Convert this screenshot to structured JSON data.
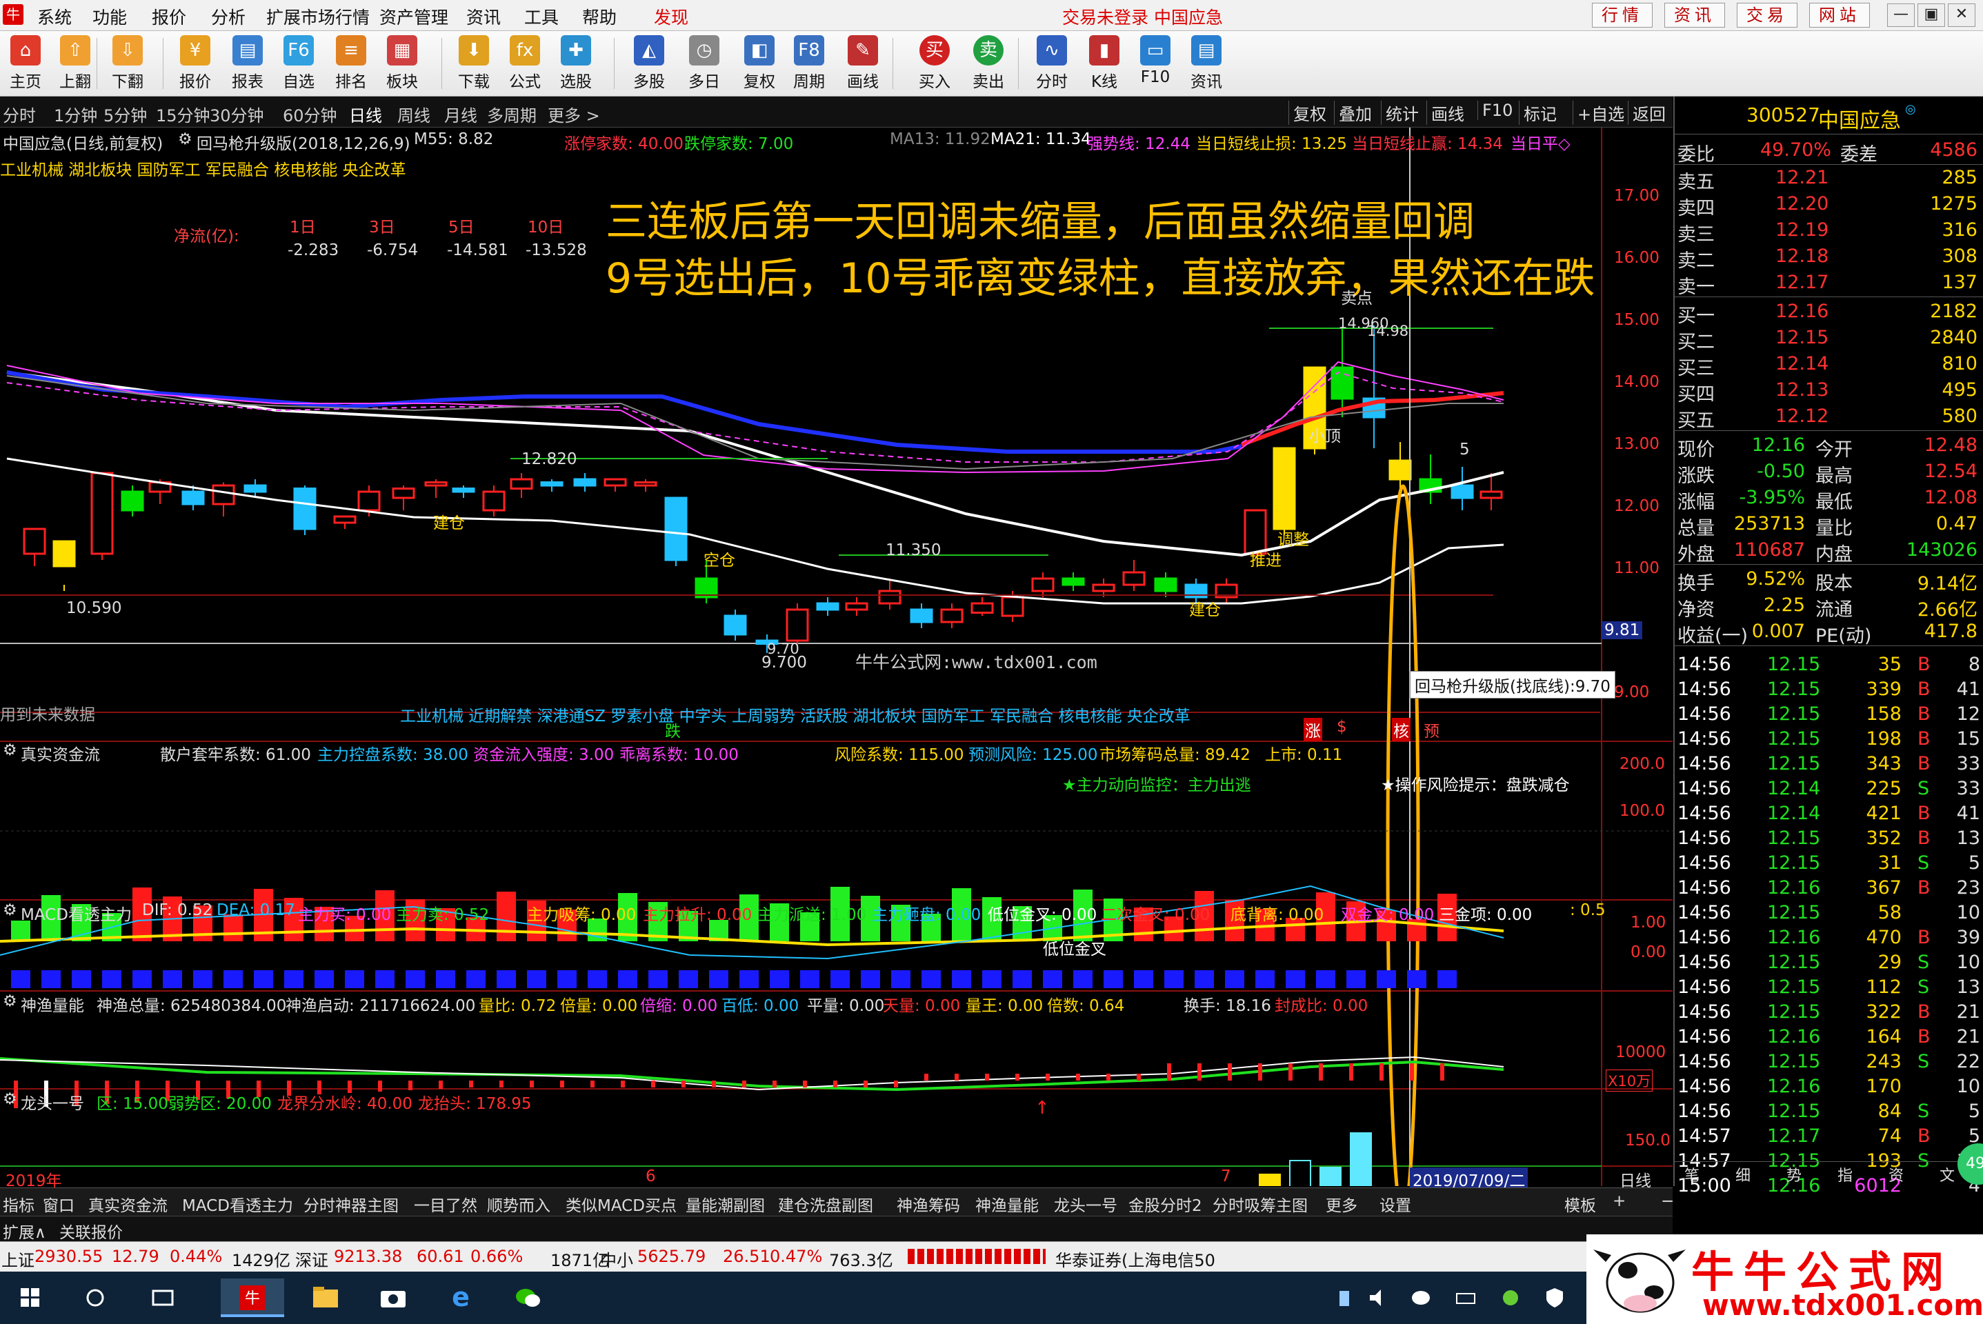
{
  "menu": {
    "items": [
      "系统",
      "功能",
      "报价",
      "分析",
      "扩展市场行情",
      "资产管理",
      "资讯",
      "工具",
      "帮助",
      "发现"
    ],
    "login_status": "交易未登录 中国应急",
    "quick_links": [
      "行情",
      "资讯",
      "交易",
      "网站"
    ],
    "window_buttons": [
      "—",
      "▣",
      "✕"
    ]
  },
  "toolbar": {
    "items": [
      "主页",
      "上翻",
      "下翻",
      "报价",
      "报表",
      "自选",
      "排名",
      "板块",
      "下载",
      "公式",
      "选股",
      "多股",
      "多日",
      "复权",
      "周期",
      "画线",
      "买入",
      "卖出",
      "分时",
      "K线",
      "F10",
      "资讯"
    ]
  },
  "periods": {
    "items": [
      "分时",
      "1分钟",
      "5分钟",
      "15分钟",
      "30分钟",
      "60分钟",
      "日线",
      "周线",
      "月线",
      "多周期",
      "更多 >"
    ],
    "active": "日线"
  },
  "chart_tools": [
    "复权",
    "叠加",
    "统计",
    "画线",
    "F10",
    "标记",
    "+自选",
    "返回"
  ],
  "main_chart": {
    "title": "中国应急(日线,前复权)",
    "indicator": "回马枪升级版(2018,12,26,9)",
    "ma55": "M55: 8.82",
    "limit_up": "涨停家数: 40.00",
    "limit_down": "跌停家数: 7.00",
    "ma13": "MA13: 11.92",
    "ma21": "MA21: 11.34",
    "strong_line": "强势线: 12.44",
    "stop_loss": "当日短线止损: 13.25",
    "stop_profit": "当日短线止赢: 14.34",
    "today_flat": "当日平◇",
    "concepts": "工业机械 湖北板块 国防军工 军民融合 核电核能 央企改革",
    "flow_label": "净流(亿):",
    "flow_headers": [
      "1日",
      "3日",
      "5日",
      "10日"
    ],
    "flow_values": [
      "-2.283",
      "-6.754",
      "-14.581",
      "-13.528"
    ],
    "annotation_line1": "三连板后第一天回调未缩量，后面虽然缩量回调",
    "annotation_line2": "9号选出后，10号乖离变绿柱，直接放弃，果然还在跌",
    "price_labels": [
      "17.00",
      "16.00",
      "15.00",
      "14.00",
      "13.00",
      "12.00",
      "11.00",
      "9.00"
    ],
    "current_price_tag": "9.81",
    "marks": {
      "sell_point": "卖点",
      "high": "14.960",
      "high2": "14.98",
      "peak": "12.820",
      "low1": "10.590",
      "low2": "9.700",
      "low3": "9.70",
      "mid": "11.350",
      "small_top": "小顶",
      "adjust": "调整",
      "push": "推进",
      "build1": "建仓",
      "build2": "建仓",
      "empty": "空仓",
      "five": "5"
    },
    "watermark": "牛牛公式网:www.tdx001.com",
    "tooltip": "回马枪升级版(找底线):9.70",
    "future_data": "用到未来数据",
    "concepts2": "工业机械 近期解禁 深港通SZ 罗素小盘 中字头 上周弱势 活跃股 湖北板块 国防军工 军民融合 核电核能 央企改革",
    "bottom_marks": [
      "跌",
      "涨",
      "$",
      "核",
      "预"
    ]
  },
  "ind1": {
    "name": "真实资金流",
    "values": [
      "散户套牢系数: 61.00",
      "主力控盘系数: 38.00",
      "资金流入强度: 3.00",
      "乖离系数: 10.00",
      "风险系数: 115.00",
      "预测风险: 125.00",
      "市场筹码总量: 89.42",
      "上市: 0.11"
    ],
    "monitor": "★主力动向监控：主力出逃",
    "risk_tip": "★操作风险提示：盘跌减仓",
    "axis": [
      "200.0",
      "100.0"
    ]
  },
  "ind2": {
    "name": "MACD看透主力",
    "values": [
      "DIF: 0.52",
      "DEA: 0.17",
      "主力买: 0.00",
      "主力卖: 0.52",
      "主力吸筹: 0.00",
      "主力拉升: 0.00",
      "主力派送: 1.00",
      "主力砸盘: 0.00",
      "低位金叉: 0.00",
      "二次金叉: 0.00",
      "底背离: 0.00",
      "双金叉: 0.00",
      "三金项: 0.00",
      ": 0.5"
    ],
    "mark": "低位金叉",
    "axis": [
      "1.00",
      "0.00"
    ]
  },
  "ind3": {
    "name": "神渔量能",
    "values": [
      "神渔总量: 625480384.00",
      "神渔启动: 211716624.00",
      "量比: 0.72",
      "倍量: 0.00",
      "倍缩: 0.00",
      "百低: 0.00",
      "平量: 0.00",
      "天量: 0.00",
      "量王: 0.00",
      "倍数: 0.64",
      "换手: 18.16",
      "封成比: 0.00"
    ],
    "axis": [
      "10000",
      "X10万"
    ]
  },
  "ind4": {
    "name": "龙头一号",
    "values": [
      "区: 15.00",
      "弱势区: 20.00",
      "龙界分水岭: 40.00",
      "龙抬头: 178.95"
    ],
    "axis": "150.0"
  },
  "time_axis": {
    "labels": [
      "2019年",
      "6",
      "7"
    ],
    "cursor": "2019/07/09/二",
    "right": "日线"
  },
  "bottom_tabs": [
    "指标",
    "窗口",
    "真实资金流",
    "MACD看透主力",
    "分时神器主图",
    "一目了然",
    "顺势而入",
    "类似MACD买点",
    "量能潮副图",
    "建仓洗盘副图",
    "神渔筹码",
    "神渔量能",
    "龙头一号",
    "金股分时2",
    "分时吸筹主图",
    "更多",
    "设置"
  ],
  "bottom_right": [
    "模板",
    "+",
    "−"
  ],
  "bottom_tabs2": [
    "扩展∧",
    "关联报价"
  ],
  "quote": {
    "code": "300527",
    "name": "中国应急",
    "ratio": {
      "label": "委比",
      "value": "49.70%",
      "label2": "委差",
      "value2": "4586"
    },
    "sells": [
      [
        "卖五",
        "12.21",
        "285"
      ],
      [
        "卖四",
        "12.20",
        "1275"
      ],
      [
        "卖三",
        "12.19",
        "316"
      ],
      [
        "卖二",
        "12.18",
        "308"
      ],
      [
        "卖一",
        "12.17",
        "137"
      ]
    ],
    "buys": [
      [
        "买一",
        "12.16",
        "2182"
      ],
      [
        "买二",
        "12.15",
        "2840"
      ],
      [
        "买三",
        "12.14",
        "810"
      ],
      [
        "买四",
        "12.13",
        "495"
      ],
      [
        "买五",
        "12.12",
        "580"
      ]
    ],
    "stats": [
      [
        "现价",
        "12.16",
        "今开",
        "12.48"
      ],
      [
        "涨跌",
        "-0.50",
        "最高",
        "12.54"
      ],
      [
        "涨幅",
        "-3.95%",
        "最低",
        "12.08"
      ],
      [
        "总量",
        "253713",
        "量比",
        "0.47"
      ],
      [
        "外盘",
        "110687",
        "内盘",
        "143026"
      ]
    ],
    "stats2": [
      [
        "换手",
        "9.52%",
        "股本",
        "9.14亿"
      ],
      [
        "净资",
        "2.25",
        "流通",
        "2.66亿"
      ],
      [
        "收益(一)",
        "0.007",
        "PE(动)",
        "417.8"
      ]
    ],
    "ticks": [
      [
        "14:56",
        "12.15",
        "35",
        "B",
        "8"
      ],
      [
        "14:56",
        "12.15",
        "339",
        "B",
        "41"
      ],
      [
        "14:56",
        "12.15",
        "158",
        "B",
        "12"
      ],
      [
        "14:56",
        "12.15",
        "198",
        "B",
        "15"
      ],
      [
        "14:56",
        "12.15",
        "343",
        "B",
        "33"
      ],
      [
        "14:56",
        "12.14",
        "225",
        "S",
        "33"
      ],
      [
        "14:56",
        "12.14",
        "421",
        "B",
        "41"
      ],
      [
        "14:56",
        "12.15",
        "352",
        "B",
        "13"
      ],
      [
        "14:56",
        "12.15",
        "31",
        "S",
        "5"
      ],
      [
        "14:56",
        "12.16",
        "367",
        "B",
        "23"
      ],
      [
        "14:56",
        "12.15",
        "58",
        "",
        "10"
      ],
      [
        "14:56",
        "12.16",
        "470",
        "B",
        "39"
      ],
      [
        "14:56",
        "12.15",
        "29",
        "S",
        "10"
      ],
      [
        "14:56",
        "12.15",
        "112",
        "S",
        "13"
      ],
      [
        "14:56",
        "12.15",
        "322",
        "B",
        "21"
      ],
      [
        "14:56",
        "12.16",
        "164",
        "B",
        "21"
      ],
      [
        "14:56",
        "12.15",
        "243",
        "S",
        "22"
      ],
      [
        "14:56",
        "12.16",
        "170",
        "",
        "10"
      ],
      [
        "14:56",
        "12.15",
        "84",
        "S",
        "5"
      ],
      [
        "14:57",
        "12.17",
        "74",
        "B",
        "5"
      ],
      [
        "14:57",
        "12.15",
        "193",
        "S",
        "13"
      ],
      [
        "15:00",
        "12.16",
        "6012",
        "",
        "4"
      ]
    ],
    "bottom": [
      "笔",
      "细",
      "势",
      "指",
      "资",
      "文"
    ]
  },
  "status": {
    "sh_label": "上证",
    "sh_value": "2930.55",
    "sh_change": "12.79",
    "sh_pct": "0.44%",
    "sh_amount": "1429亿",
    "sz_label": "深证",
    "sz_value": "9213.38",
    "sz_change": "60.61",
    "sz_pct": "0.66%",
    "sz_amount": "1871亿",
    "sm_label": "中小",
    "sm_value": "5625.79",
    "sm_change": "26.51",
    "sm_pct": "0.47%",
    "sm_amount": "763.3亿",
    "broker": "华泰证券(上海电信50"
  },
  "logo": {
    "text": "牛牛公式网",
    "url": "www.tdx001.com"
  },
  "badge": "49",
  "colors": {
    "up": "#ff2020",
    "down": "#00e000",
    "accent": "#ffd700",
    "panel_bg": "#000000",
    "menu_bg": "#f1f1f1",
    "annotation": "#ffc000",
    "blue_line": "#2030ff"
  }
}
